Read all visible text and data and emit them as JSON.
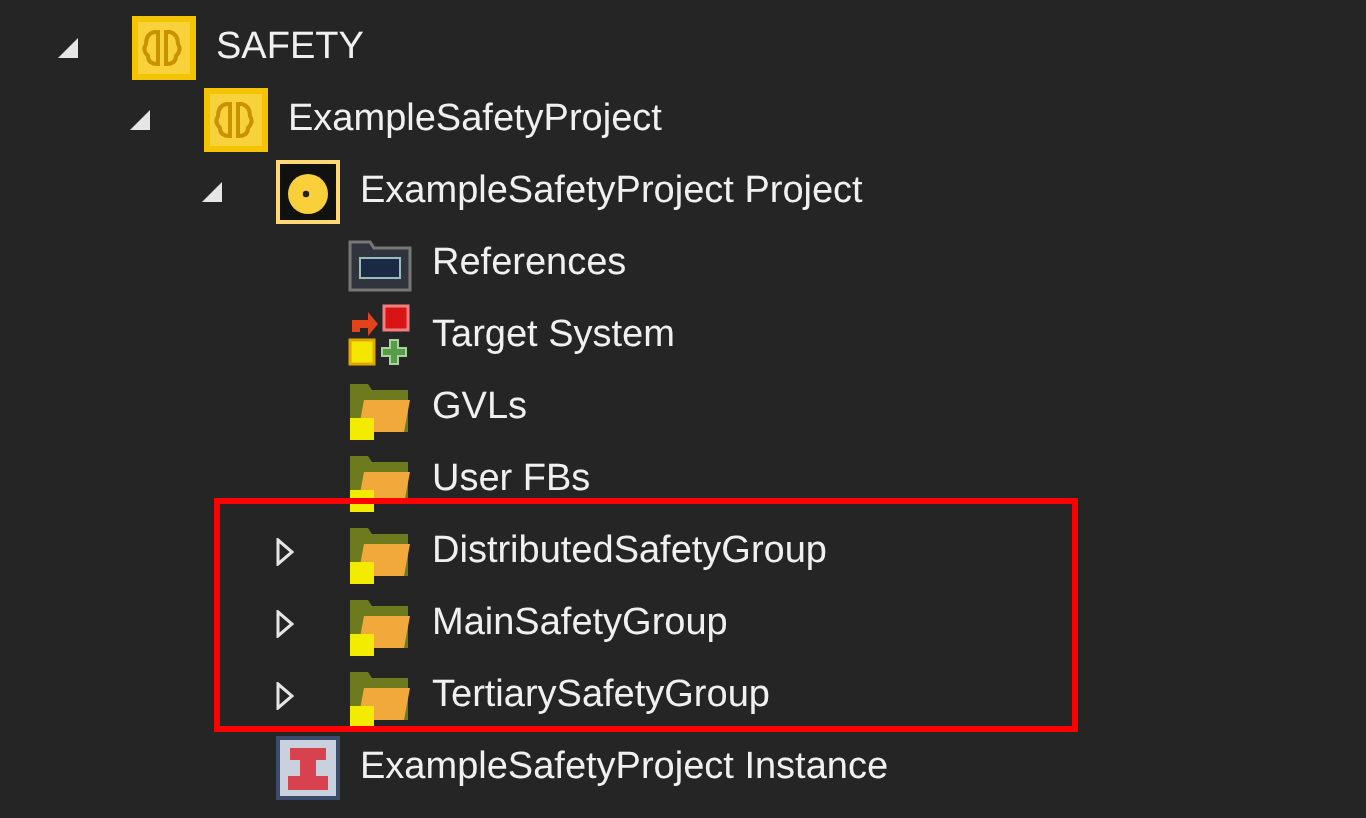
{
  "tree": [
    {
      "label": "SAFETY",
      "kind": "safety",
      "expanded": true,
      "children": [
        {
          "label": "ExampleSafetyProject",
          "kind": "safety",
          "expanded": true,
          "children": [
            {
              "label": "ExampleSafetyProject Project",
              "kind": "project",
              "expanded": true,
              "children": [
                {
                  "label": "References",
                  "kind": "references"
                },
                {
                  "label": "Target System",
                  "kind": "target"
                },
                {
                  "label": "GVLs",
                  "kind": "folder"
                },
                {
                  "label": "User FBs",
                  "kind": "folder"
                },
                {
                  "label": "DistributedSafetyGroup",
                  "kind": "folder",
                  "expanded": false,
                  "highlighted": true
                },
                {
                  "label": "MainSafetyGroup",
                  "kind": "folder",
                  "expanded": false,
                  "highlighted": true
                },
                {
                  "label": "TertiarySafetyGroup",
                  "kind": "folder",
                  "expanded": false,
                  "highlighted": true
                }
              ]
            },
            {
              "label": "ExampleSafetyProject Instance",
              "kind": "instance"
            }
          ]
        }
      ]
    }
  ]
}
